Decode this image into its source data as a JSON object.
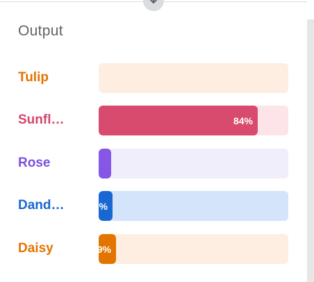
{
  "panel": {
    "title": "Output"
  },
  "rows": [
    {
      "label": "Tulip",
      "value": 0,
      "pct_text": "",
      "label_color": "#e37400",
      "fill_color": "#f9a826",
      "track_color": "#feede1"
    },
    {
      "label": "Sunfl…",
      "value": 84,
      "pct_text": "84%",
      "label_color": "#d6456b",
      "fill_color": "#d94b6e",
      "track_color": "#fde4e9"
    },
    {
      "label": "Rose",
      "value": 1,
      "pct_text": "",
      "label_color": "#7a4fe0",
      "fill_color": "#8656e6",
      "track_color": "#f0eefb"
    },
    {
      "label": "Dand…",
      "value": 6,
      "pct_text": "%",
      "label_color": "#1967d2",
      "fill_color": "#1967d2",
      "track_color": "#d4e4fb"
    },
    {
      "label": "Daisy",
      "value": 9,
      "pct_text": "9%",
      "label_color": "#e37400",
      "fill_color": "#e37400",
      "track_color": "#feede1"
    }
  ]
}
